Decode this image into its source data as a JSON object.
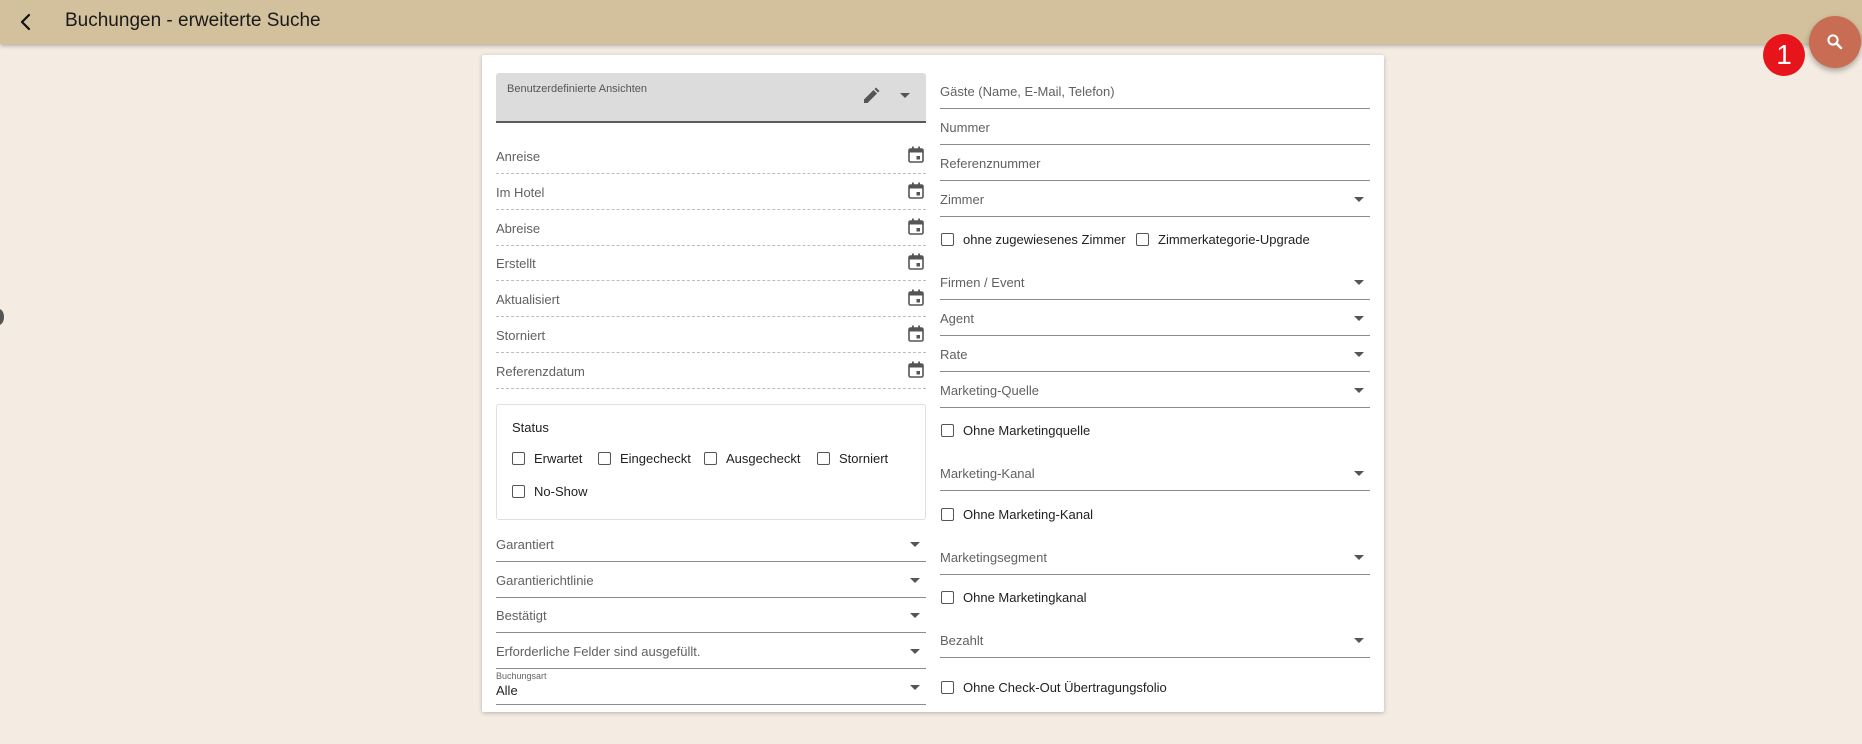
{
  "header": {
    "title": "Buchungen - erweiterte Suche"
  },
  "badge": {
    "count": "1"
  },
  "colors": {
    "appbar": "#d2c19c",
    "background": "#f4ece2",
    "fab": "#c86c54",
    "badge": "#e8141c"
  },
  "icons": {
    "back": "arrow-back-icon",
    "search": "search-icon",
    "edit": "pencil-icon",
    "calendar": "calendar-icon",
    "dropdown": "caret-down-icon"
  },
  "left": {
    "custom_views_label": "Benutzerdefinierte Ansichten",
    "date_fields": [
      "Anreise",
      "Im Hotel",
      "Abreise",
      "Erstellt",
      "Aktualisiert",
      "Storniert",
      "Referenzdatum"
    ],
    "status": {
      "title": "Status",
      "options": [
        "Erwartet",
        "Eingecheckt",
        "Ausgecheckt",
        "Storniert",
        "No-Show"
      ]
    },
    "selects": [
      "Garantiert",
      "Garantierichtlinie",
      "Bestätigt",
      "Erforderliche Felder sind ausgefüllt."
    ],
    "booking_type": {
      "label": "Buchungsart",
      "value": "Alle"
    }
  },
  "right": {
    "guests": "Gäste (Name, E-Mail, Telefon)",
    "number": "Nummer",
    "reference": "Referenznummer",
    "room": "Zimmer",
    "no_room": "ohne zugewiesenes Zimmer",
    "room_upgrade": "Zimmerkategorie-Upgrade",
    "companies": "Firmen / Event",
    "agent": "Agent",
    "rate": "Rate",
    "marketing_source": "Marketing-Quelle",
    "no_marketing_source": "Ohne Marketingquelle",
    "marketing_channel": "Marketing-Kanal",
    "no_marketing_channel": "Ohne Marketing-Kanal",
    "marketing_segment": "Marketingsegment",
    "no_marketing_segment": "Ohne Marketingkanal",
    "paid": "Bezahlt",
    "no_checkout_folio": "Ohne Check-Out Übertragungsfolio"
  }
}
